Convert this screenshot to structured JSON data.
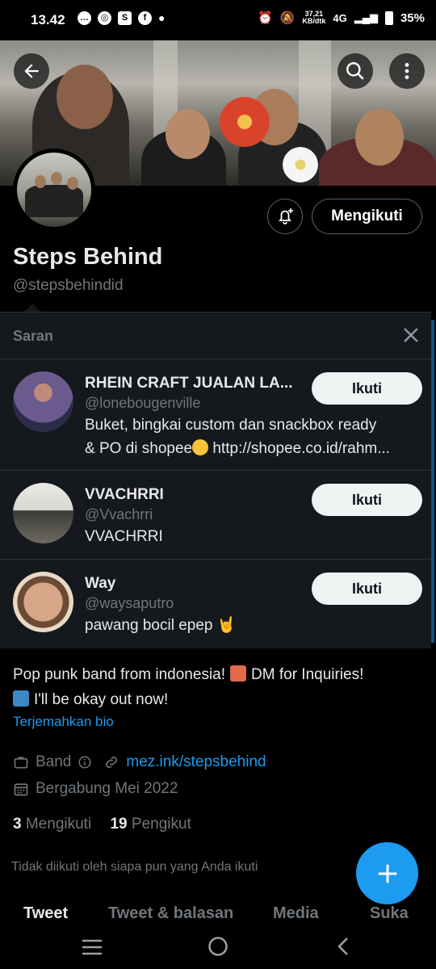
{
  "status_bar": {
    "time": "13.42",
    "speed_top": "37,21",
    "speed_bottom": "KB/dtk",
    "network": "4G",
    "battery": "35%"
  },
  "profile": {
    "name": "Steps Behind",
    "handle": "@stepsbehindid",
    "follow_label": "Mengikuti"
  },
  "suggestions": {
    "title": "Saran",
    "items": [
      {
        "name": "RHEIN CRAFT JUALAN LA...",
        "handle": "@lonebougenville",
        "bio_line1": "Buket, bingkai custom dan snackbox ready",
        "bio_line2_pre": "& PO di shopee",
        "bio_line2_post": " http://shopee.co.id/rahm...",
        "button": "Ikuti"
      },
      {
        "name": "VVACHRRI",
        "handle": "@Vvachrri",
        "bio_line1": "VVACHRRI",
        "button": "Ikuti"
      },
      {
        "name": "Way",
        "handle": "@waysaputro",
        "bio_line1": "pawang bocil epep",
        "emoji": "🤘",
        "button": "Ikuti"
      }
    ]
  },
  "bio": {
    "line1_pre": "Pop punk band from indonesia!",
    "line1_post": "DM for Inquiries!",
    "line2": "I'll be okay out now!",
    "translate": "Terjemahkan bio"
  },
  "meta": {
    "category": "Band",
    "link": "mez.ink/stepsbehind",
    "joined": "Bergabung Mei 2022"
  },
  "counts": {
    "following_num": "3",
    "following_label": "Mengikuti",
    "followers_num": "19",
    "followers_label": "Pengikut"
  },
  "not_followed_text": "Tidak diikuti oleh siapa pun yang Anda ikuti",
  "tabs": [
    "Tweet",
    "Tweet & balasan",
    "Media",
    "Suka"
  ],
  "colors": {
    "accent": "#1d9bf0",
    "background": "#000000",
    "card": "#15181c",
    "muted": "#71767b"
  }
}
